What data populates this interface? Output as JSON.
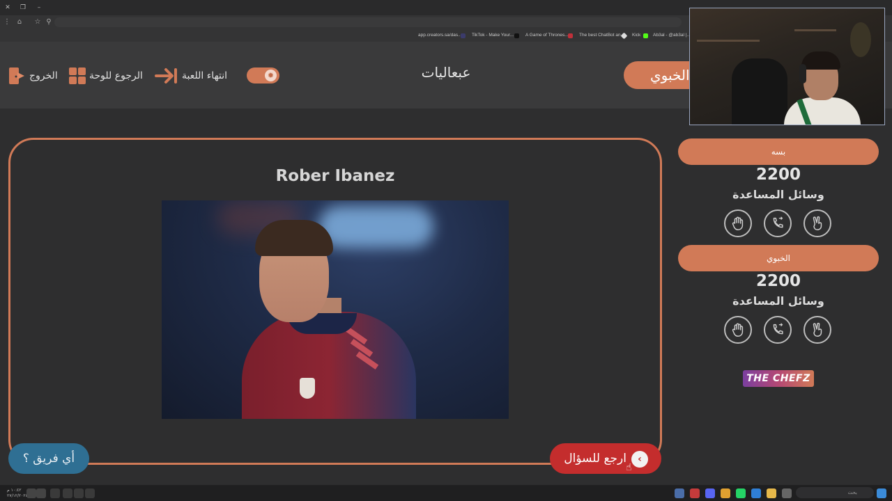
{
  "browser": {
    "bookmarks": [
      {
        "label": "app.creators.sa/das..."
      },
      {
        "label": "TikTok - Make Your..."
      },
      {
        "label": "A Game of Thrones..."
      },
      {
        "label": "The best ChatBot an..."
      },
      {
        "label": "Kick"
      },
      {
        "label": "Ab3al - @ab3al |..."
      }
    ]
  },
  "header": {
    "exit_label": "الخروج",
    "back_to_board_label": "الرجوع للوحة",
    "end_game_label": "انتهاء اللعبة",
    "game_title": "عبعاليات",
    "current_team": "الخبوي"
  },
  "question": {
    "player_name": "Rober Ibanez",
    "which_team_label": "أي فريق ؟",
    "back_to_question_label": "ارجع للسؤال"
  },
  "teams": [
    {
      "name": "بسه",
      "score": "2200",
      "helpers_label": "وسائل المساعدة"
    },
    {
      "name": "الخبوي",
      "score": "2200",
      "helpers_label": "وسائل المساعدة"
    }
  ],
  "helpers": [
    {
      "icon": "hand-stop-icon"
    },
    {
      "icon": "call-icon"
    },
    {
      "icon": "peace-hand-icon"
    }
  ],
  "logo": {
    "text": "THE CHEFZ"
  },
  "taskbar": {
    "time": "١٠:٤٢ م",
    "date": "٢٧/١٢/٢٠٢٤",
    "search_placeholder": "بحث"
  },
  "colors": {
    "accent": "#d17a57",
    "team_button": "#2f6f93",
    "back_button": "#c42d2d",
    "background": "#2e2e2f"
  }
}
